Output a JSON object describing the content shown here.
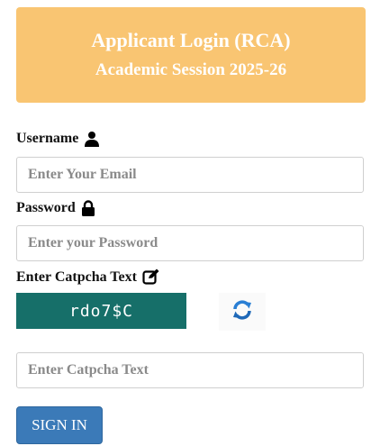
{
  "header": {
    "title": "Applicant Login (RCA)",
    "subtitle": "Academic Session 2025-26"
  },
  "username": {
    "label": "Username",
    "icon": "user-icon",
    "placeholder": "Enter Your Email",
    "value": ""
  },
  "password": {
    "label": "Password",
    "icon": "lock-icon",
    "placeholder": "Enter your Password",
    "value": ""
  },
  "captcha": {
    "label": "Enter Catpcha Text",
    "icon": "edit-icon",
    "image_text": "rdo7$C",
    "refresh_icon": "refresh-icon",
    "placeholder": "Enter Catpcha Text",
    "value": ""
  },
  "actions": {
    "signin_label": "SIGN IN"
  },
  "colors": {
    "header_bg": "#f9c572",
    "captcha_bg": "#166f69",
    "button_bg": "#3b7ab8"
  }
}
